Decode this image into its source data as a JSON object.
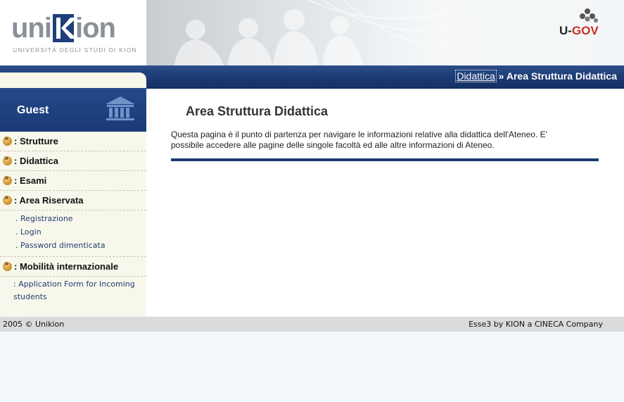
{
  "header": {
    "logo_part1": "uni",
    "logo_part2": "ion",
    "logo_subtitle": "UNIVERSITÀ DEGLI STUDI DI KION",
    "partner_logo_u": "U-",
    "partner_logo_gov": "GOV"
  },
  "breadcrumb": {
    "link": "Didattica",
    "separator": " » ",
    "current": "Area Struttura Didattica"
  },
  "sidebar": {
    "user_label": "Guest",
    "items": [
      {
        "label": ": Strutture"
      },
      {
        "label": ": Didattica"
      },
      {
        "label": ": Esami"
      },
      {
        "label": ": Area Riservata",
        "subitems": [
          ". Registrazione",
          ". Login",
          ". Password dimenticata"
        ]
      },
      {
        "label": ": Mobilità internazionale",
        "subitems": [
          ":  Application Form for Incoming students"
        ]
      }
    ]
  },
  "main": {
    "title": "Area Struttura Didattica",
    "intro": "Questa pagina è il punto di partenza per navigare le informazioni relative alla didattica dell'Ateneo. E' possibile accedere alle pagine delle singole facoltà ed alle altre informazioni di Ateneo."
  },
  "footer": {
    "left": "2005 © Unikion",
    "right": "Esse3 by KION a CINECA Company"
  },
  "colors": {
    "navy": "#1a3871",
    "accent_bullet": "#cf952e",
    "sidebar_bg": "#f7f7ec",
    "footer_bg": "#d9dbdc",
    "ugov_red": "#c8301e"
  }
}
